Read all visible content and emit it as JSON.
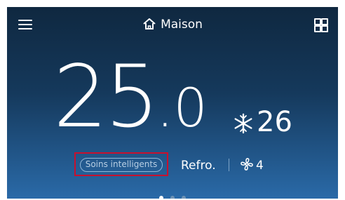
{
  "header": {
    "menu_icon": "hamburger-menu-icon",
    "home_icon": "home-icon",
    "title": "Maison",
    "grid_icon": "grid-icon"
  },
  "climate": {
    "current_temp_int": "25",
    "current_temp_dec": ".0",
    "cool_icon": "snowflake-icon",
    "target_temp": "26"
  },
  "controls": {
    "smart_care_label": "Soins intelligents",
    "mode": "Refro.",
    "fan_icon": "fan-icon",
    "fan_speed": "4"
  },
  "pager": {
    "pages": 3,
    "active": 0
  },
  "colors": {
    "highlight": "#c8102e",
    "background_top": "#0f2840",
    "background_bottom": "#2a6aa8"
  }
}
